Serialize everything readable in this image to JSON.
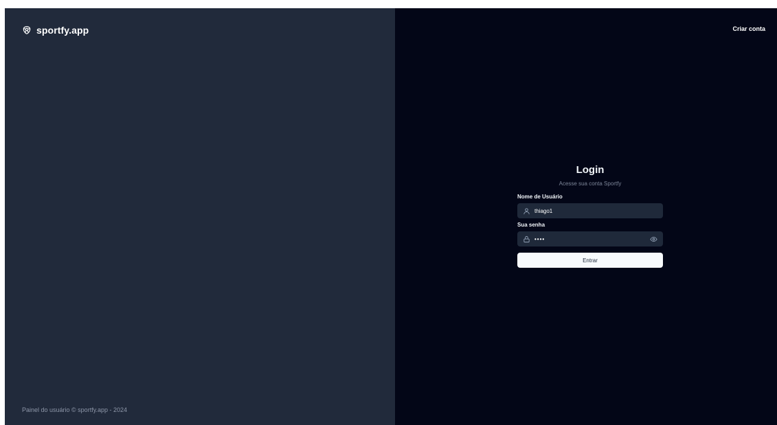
{
  "brand": {
    "name": "sportfy.app",
    "icon": "soccer-ball-icon"
  },
  "footer": {
    "text": "Painel do usuário © sportfy.app - 2024"
  },
  "header": {
    "create_account_label": "Criar conta"
  },
  "login": {
    "title": "Login",
    "subtitle": "Acesse sua conta Sportfy",
    "username": {
      "label": "Nome de Usuário",
      "value": "thiago1",
      "icon": "user-icon"
    },
    "password": {
      "label": "Sua senha",
      "value": "••••",
      "icon": "lock-icon",
      "toggle_icon": "eye-icon"
    },
    "submit_label": "Entrar"
  },
  "colors": {
    "left_panel_bg": "#212a3b",
    "right_panel_bg": "#030617",
    "input_bg": "#1f293a",
    "button_bg": "#f8fafc",
    "muted_text": "#7c8598"
  }
}
